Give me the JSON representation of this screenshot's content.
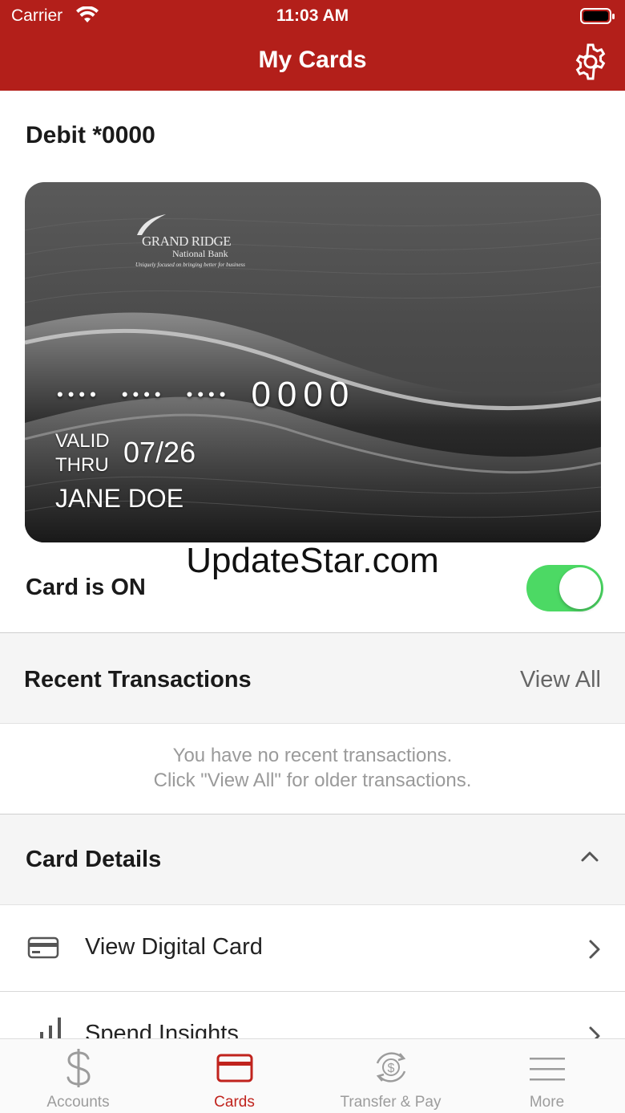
{
  "status_bar": {
    "carrier": "Carrier",
    "time": "11:03 AM"
  },
  "header": {
    "title": "My Cards",
    "settings_icon": "gear-icon"
  },
  "card": {
    "name": "Debit *0000",
    "bank_name": "GRAND RIDGE",
    "bank_sub": "National Bank",
    "bank_tagline": "Uniquely focused on bringing better for business",
    "masked_groups": [
      "••••",
      "••••",
      "••••"
    ],
    "last4": "0000",
    "valid_line1": "VALID",
    "valid_line2": "THRU",
    "expiry": "07/26",
    "holder": "JANE DOE"
  },
  "watermark": "UpdateStar.com",
  "card_status": {
    "label": "Card is ON",
    "enabled": true,
    "toggle_color": "#4cd964"
  },
  "recent_transactions": {
    "title": "Recent Transactions",
    "view_all": "View All",
    "empty_line1": "You have no recent transactions.",
    "empty_line2": "Click \"View All\" for older transactions."
  },
  "card_details": {
    "title": "Card Details",
    "items": [
      {
        "label": "View Digital Card",
        "icon": "credit-card-icon"
      },
      {
        "label": "Spend Insights",
        "icon": "bar-chart-icon"
      }
    ]
  },
  "tabs": [
    {
      "label": "Accounts",
      "icon": "dollar-icon",
      "active": false
    },
    {
      "label": "Cards",
      "icon": "card-icon",
      "active": true
    },
    {
      "label": "Transfer & Pay",
      "icon": "transfer-icon",
      "active": false
    },
    {
      "label": "More",
      "icon": "menu-icon",
      "active": false
    }
  ],
  "colors": {
    "brand": "#b31f1a",
    "active_tab": "#c0231d",
    "inactive_tab": "#9c9c9c"
  }
}
